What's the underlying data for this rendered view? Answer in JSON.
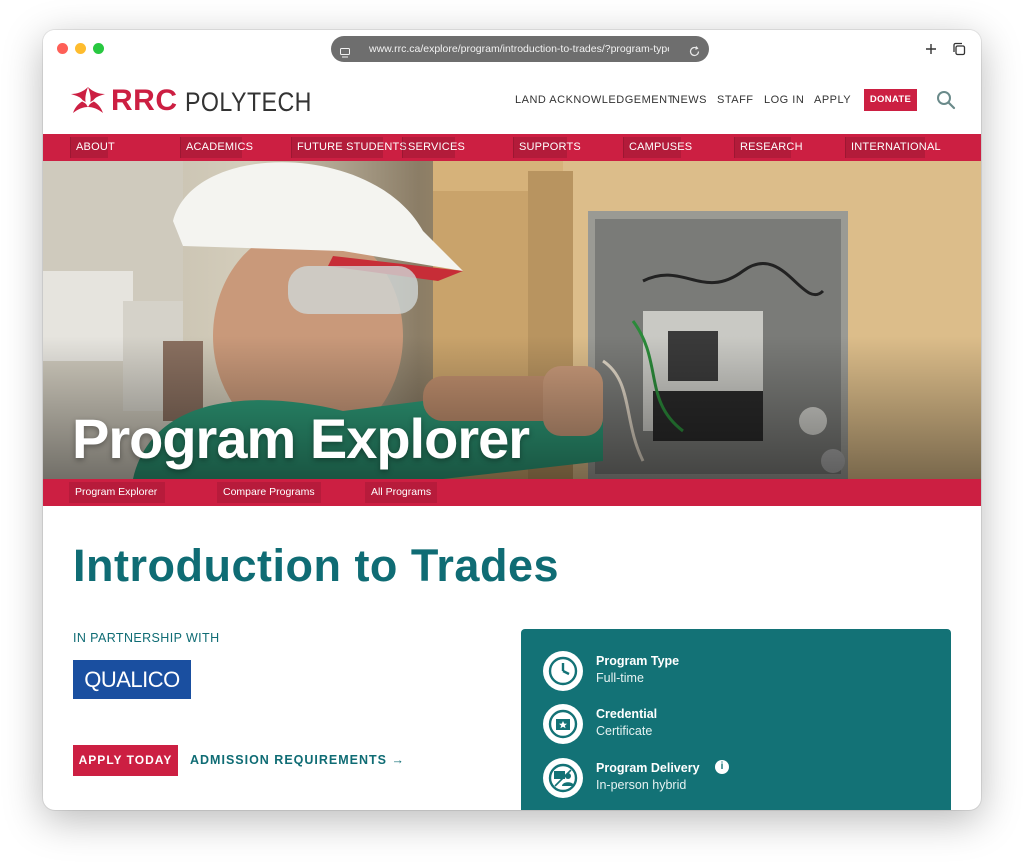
{
  "browser": {
    "url": "www.rrc.ca/explore/program/introduction-to-trades/?program-type"
  },
  "logo": {
    "brand": "RRC",
    "suffix": "POLYTECH"
  },
  "utility_nav": [
    {
      "label": "LAND ACKNOWLEDGEMENT"
    },
    {
      "label": "NEWS"
    },
    {
      "label": "STAFF"
    },
    {
      "label": "LOG IN"
    },
    {
      "label": "APPLY"
    }
  ],
  "donate_label": "DONATE",
  "main_nav": [
    {
      "label": "ABOUT"
    },
    {
      "label": "ACADEMICS"
    },
    {
      "label": "FUTURE STUDENTS"
    },
    {
      "label": "SERVICES"
    },
    {
      "label": "SUPPORTS"
    },
    {
      "label": "CAMPUSES"
    },
    {
      "label": "RESEARCH"
    },
    {
      "label": "INTERNATIONAL"
    }
  ],
  "hero": {
    "title": "Program Explorer"
  },
  "sub_nav": [
    {
      "label": "Program Explorer"
    },
    {
      "label": "Compare Programs"
    },
    {
      "label": "All Programs"
    }
  ],
  "program": {
    "title": "Introduction to Trades",
    "partner_label": "IN PARTNERSHIP WITH",
    "partner_logo": "QUALICO",
    "apply_label": "APPLY TODAY",
    "admission_label": "ADMISSION REQUIREMENTS →"
  },
  "info": [
    {
      "label": "Program Type",
      "value": "Full-time",
      "icon": "clock-icon"
    },
    {
      "label": "Credential",
      "value": "Certificate",
      "icon": "certificate-icon"
    },
    {
      "label": "Program Delivery",
      "value": "In-person hybrid",
      "icon": "delivery-icon"
    }
  ],
  "colors": {
    "brand_red": "#cc1f42",
    "teal": "#0f6c74",
    "card_teal": "#137276",
    "partner_blue": "#1a4fa0"
  }
}
